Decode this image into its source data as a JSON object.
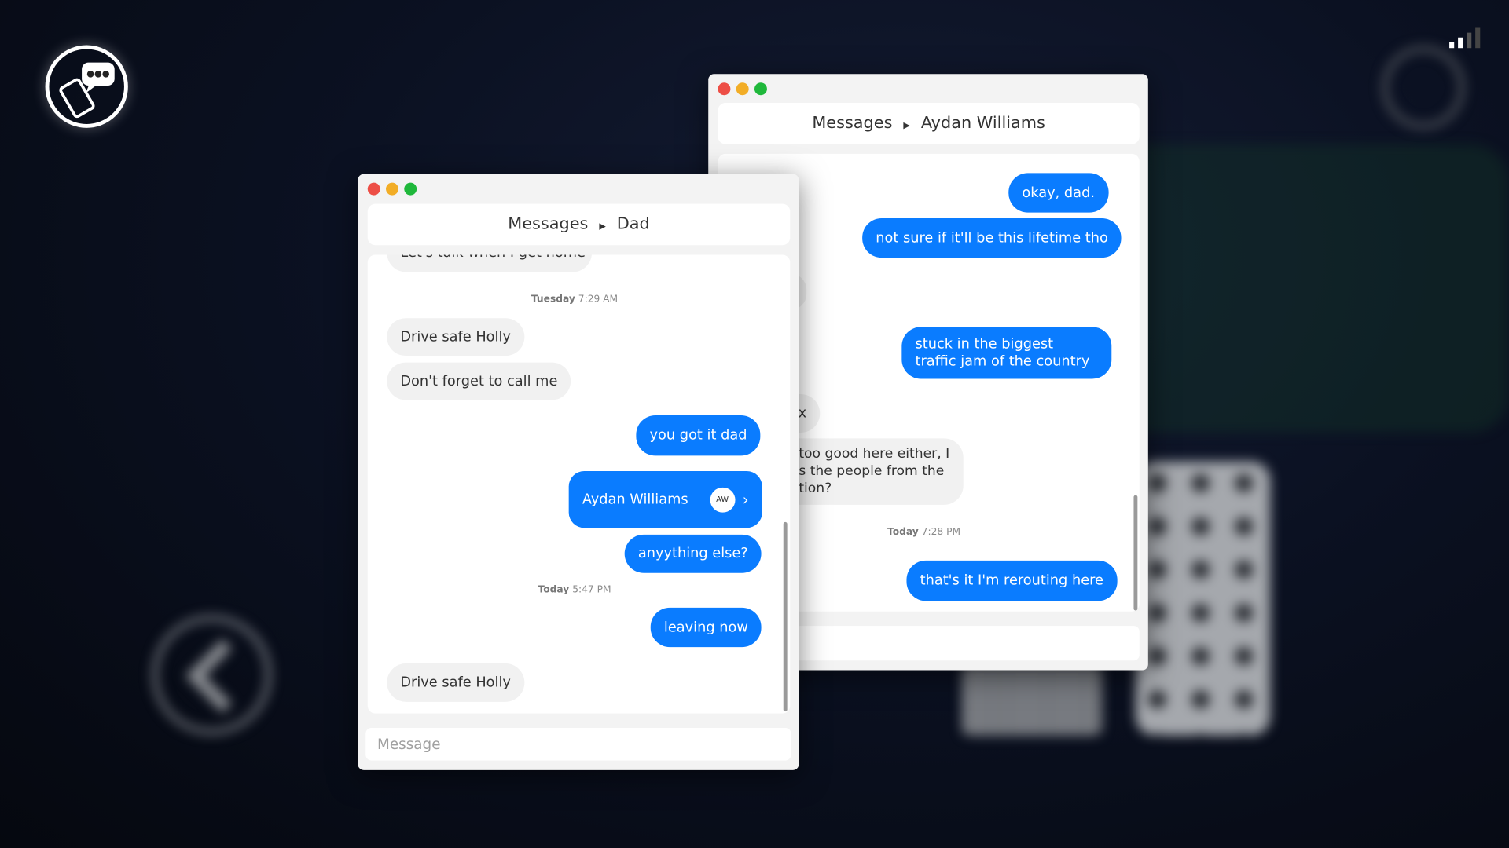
{
  "colors": {
    "accent": "#0a7cff",
    "incoming": "#f1f1f1",
    "close": "#ed4e46",
    "minimize": "#f2ad26",
    "maximize": "#1fb83b"
  },
  "icons": {
    "logo": "chat-phone-logo-icon",
    "signal": "signal-bars-icon",
    "back": "chevron-left-icon",
    "steering": "steering-wheel-icon"
  },
  "dad_window": {
    "title_app": "Messages",
    "title_contact": "Dad",
    "messages": [
      {
        "type": "in",
        "text": "Let's talk when I get home"
      },
      {
        "type": "timestamp",
        "day": "Tuesday",
        "time": "7:29 AM"
      },
      {
        "type": "in",
        "text": "Drive safe Holly"
      },
      {
        "type": "in",
        "text": "Don't forget to call me"
      },
      {
        "type": "out",
        "text": "you got it dad"
      },
      {
        "type": "contact_card",
        "name": "Aydan Williams",
        "initials": "AW"
      },
      {
        "type": "out",
        "text": "anyything else?"
      },
      {
        "type": "timestamp",
        "day": "Today",
        "time": "5:47 PM"
      },
      {
        "type": "out",
        "text": "leaving now"
      },
      {
        "type": "in",
        "text": "Drive safe Holly"
      }
    ],
    "input_placeholder": "Message"
  },
  "aydan_window": {
    "title_app": "Messages",
    "title_contact": "Aydan Williams",
    "messages": [
      {
        "type": "out",
        "text": "okay, dad."
      },
      {
        "type": "out",
        "text": "not sure if it'll be this lifetime tho"
      },
      {
        "type": "out",
        "text": "stuck in the biggest traffic jam of the country"
      },
      {
        "type": "in",
        "text": "x"
      },
      {
        "type": "in",
        "lines": [
          "too good here either, I",
          "s the people from the",
          "tion?"
        ]
      },
      {
        "type": "timestamp",
        "day": "Today",
        "time": "7:28 PM"
      },
      {
        "type": "out",
        "text": "that's it I'm rerouting here"
      }
    ]
  }
}
